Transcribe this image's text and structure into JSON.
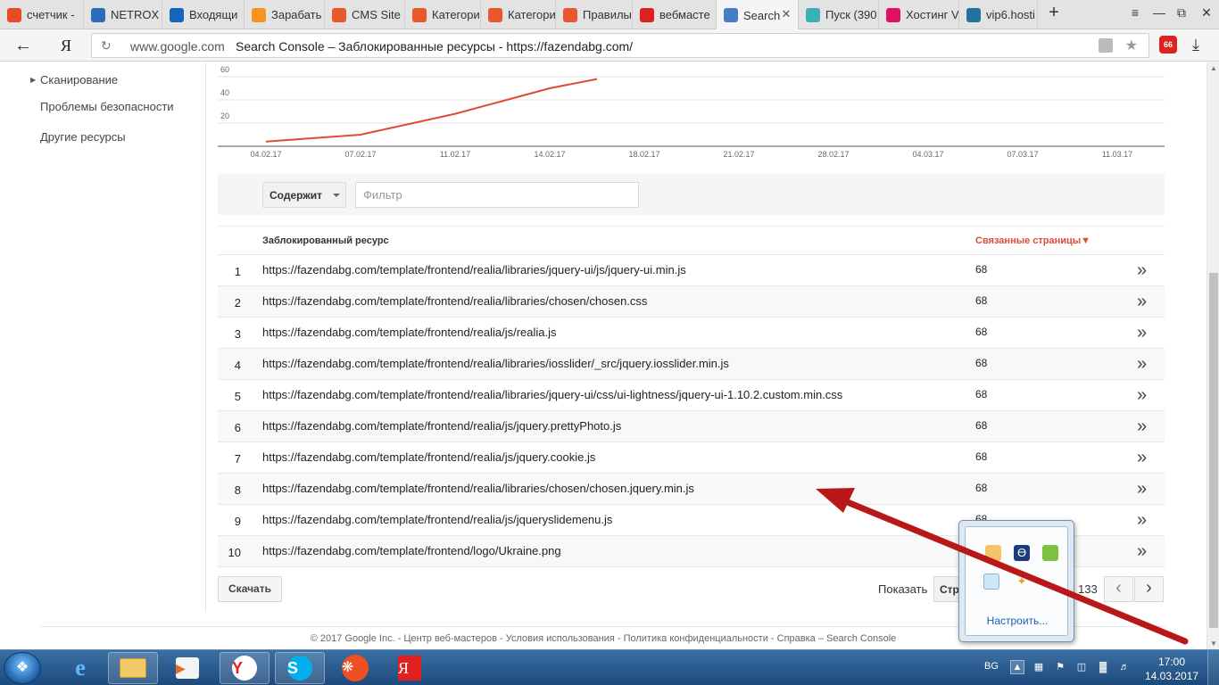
{
  "browser": {
    "tabs": [
      {
        "label": "счетчик -",
        "icon": "bar-chart-icon",
        "color": "#e44d26"
      },
      {
        "label": "NETROX -",
        "icon": "netrox-icon",
        "color": "#2a6ebb"
      },
      {
        "label": "Входящи",
        "icon": "mail-icon",
        "color": "#1565c0"
      },
      {
        "label": "Зарабать",
        "icon": "orange-circle-icon",
        "color": "#f7931e"
      },
      {
        "label": "CMS Site",
        "icon": "s-icon",
        "color": "#e8582a"
      },
      {
        "label": "Категори",
        "icon": "s-icon",
        "color": "#e8582a"
      },
      {
        "label": "Категори",
        "icon": "s-icon",
        "color": "#e8582a"
      },
      {
        "label": "Правилы",
        "icon": "s-icon",
        "color": "#e8582a"
      },
      {
        "label": "вебмасте",
        "icon": "yandex-icon",
        "color": "#e01f1f"
      },
      {
        "label": "Search",
        "icon": "search-console-icon",
        "color": "#4a7bc8",
        "active": true
      },
      {
        "label": "Пуск (390",
        "icon": "flag-icon",
        "color": "#3bb0b8"
      },
      {
        "label": "Хостинг V",
        "icon": "hosting-icon",
        "color": "#e0115f"
      },
      {
        "label": "vip6.hosti",
        "icon": "wordpress-icon",
        "color": "#21759b"
      }
    ],
    "new_tab_label": "+",
    "address": {
      "domain": "www.google.com",
      "title": "Search Console – Заблокированные ресурсы - https://fazendabg.com/"
    },
    "yandex_button": "Я",
    "extension_badge": "66"
  },
  "sidebar": {
    "items": [
      {
        "label": "Сканирование",
        "expandable": true
      },
      {
        "label": "Проблемы безопасности"
      },
      {
        "label": "Другие ресурсы"
      }
    ]
  },
  "chart_data": {
    "type": "line",
    "title": "",
    "xlabel": "",
    "ylabel": "",
    "x_ticks": [
      "04.02.17",
      "07.02.17",
      "11.02.17",
      "14.02.17",
      "18.02.17",
      "21.02.17",
      "28.02.17",
      "04.03.17",
      "07.03.17",
      "11.03.17"
    ],
    "y_ticks": [
      "20",
      "40",
      "60"
    ],
    "ylim": [
      0,
      80
    ],
    "series": [
      {
        "color": "#dd4b39",
        "x": [
          "04.02.17",
          "07.02.17",
          "11.02.17",
          "14.02.17",
          "16.02.17"
        ],
        "values": [
          4,
          10,
          28,
          50,
          58
        ]
      }
    ],
    "grid": true
  },
  "filter": {
    "select_label": "Содержит",
    "input_placeholder": "Фильтр"
  },
  "table": {
    "headers": {
      "resource": "Заблокированный ресурс",
      "pages": "Связанные страницы▼"
    },
    "rows": [
      {
        "num": "1",
        "url": "https://fazendabg.com/template/frontend/realia/libraries/jquery-ui/js/jquery-ui.min.js",
        "count": "68"
      },
      {
        "num": "2",
        "url": "https://fazendabg.com/template/frontend/realia/libraries/chosen/chosen.css",
        "count": "68"
      },
      {
        "num": "3",
        "url": "https://fazendabg.com/template/frontend/realia/js/realia.js",
        "count": "68"
      },
      {
        "num": "4",
        "url": "https://fazendabg.com/template/frontend/realia/libraries/iosslider/_src/jquery.iosslider.min.js",
        "count": "68"
      },
      {
        "num": "5",
        "url": "https://fazendabg.com/template/frontend/realia/libraries/jquery-ui/css/ui-lightness/jquery-ui-1.10.2.custom.min.css",
        "count": "68"
      },
      {
        "num": "6",
        "url": "https://fazendabg.com/template/frontend/realia/js/jquery.prettyPhoto.js",
        "count": "68"
      },
      {
        "num": "7",
        "url": "https://fazendabg.com/template/frontend/realia/js/jquery.cookie.js",
        "count": "68"
      },
      {
        "num": "8",
        "url": "https://fazendabg.com/template/frontend/realia/libraries/chosen/chosen.jquery.min.js",
        "count": "68"
      },
      {
        "num": "9",
        "url": "https://fazendabg.com/template/frontend/realia/js/jqueryslidemenu.js",
        "count": "68"
      },
      {
        "num": "10",
        "url": "https://fazendabg.com/template/frontend/logo/Ukraine.png",
        "count": ""
      }
    ],
    "more_glyph": "»"
  },
  "controls": {
    "download_label": "Скачать",
    "show_label": "Показать",
    "rows_select_label": "Стро",
    "range_text": "133",
    "prev_glyph": "‹",
    "next_glyph": "›"
  },
  "footer": {
    "text": "© 2017 Google Inc. - Центр веб-мастеров - Условия использования - Политика конфиденциальности - Справка – Search Console"
  },
  "tray_popup": {
    "configure_label": "Настроить..."
  },
  "taskbar": {
    "lang": "BG",
    "time": "17:00",
    "date": "14.03.2017"
  },
  "annotation_color": "#b81818"
}
